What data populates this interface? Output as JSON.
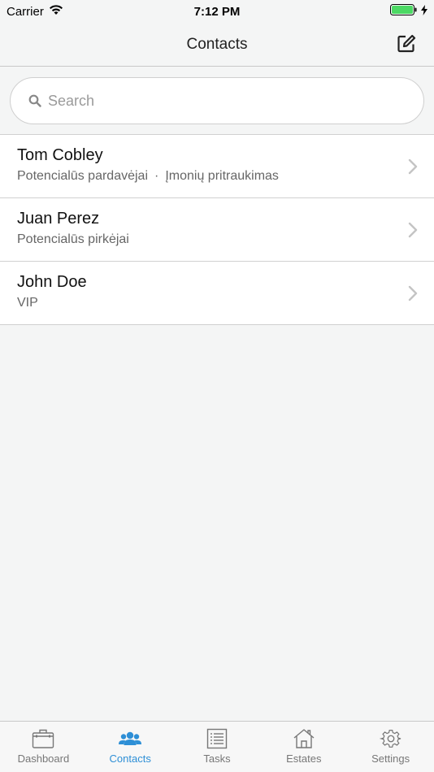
{
  "status_bar": {
    "carrier": "Carrier",
    "time": "7:12 PM",
    "battery_color": "#4cd964"
  },
  "nav": {
    "title": "Contacts",
    "compose_icon": "compose-icon"
  },
  "search": {
    "placeholder": "Search",
    "value": ""
  },
  "contacts": [
    {
      "name": "Tom Cobley",
      "tags": [
        "Potencialūs pardavėjai",
        "Įmonių pritraukimas"
      ]
    },
    {
      "name": "Juan Perez",
      "tags": [
        "Potencialūs pirkėjai"
      ]
    },
    {
      "name": "John Doe",
      "tags": [
        "VIP"
      ]
    }
  ],
  "tabs": [
    {
      "label": "Dashboard",
      "icon": "briefcase-icon",
      "active": false
    },
    {
      "label": "Contacts",
      "icon": "people-icon",
      "active": true
    },
    {
      "label": "Tasks",
      "icon": "list-icon",
      "active": false
    },
    {
      "label": "Estates",
      "icon": "house-icon",
      "active": false
    },
    {
      "label": "Settings",
      "icon": "gear-icon",
      "active": false
    }
  ],
  "colors": {
    "accent": "#2e8fd6",
    "background": "#f4f5f5",
    "tab_inactive": "#777777"
  },
  "tag_separator": "·"
}
